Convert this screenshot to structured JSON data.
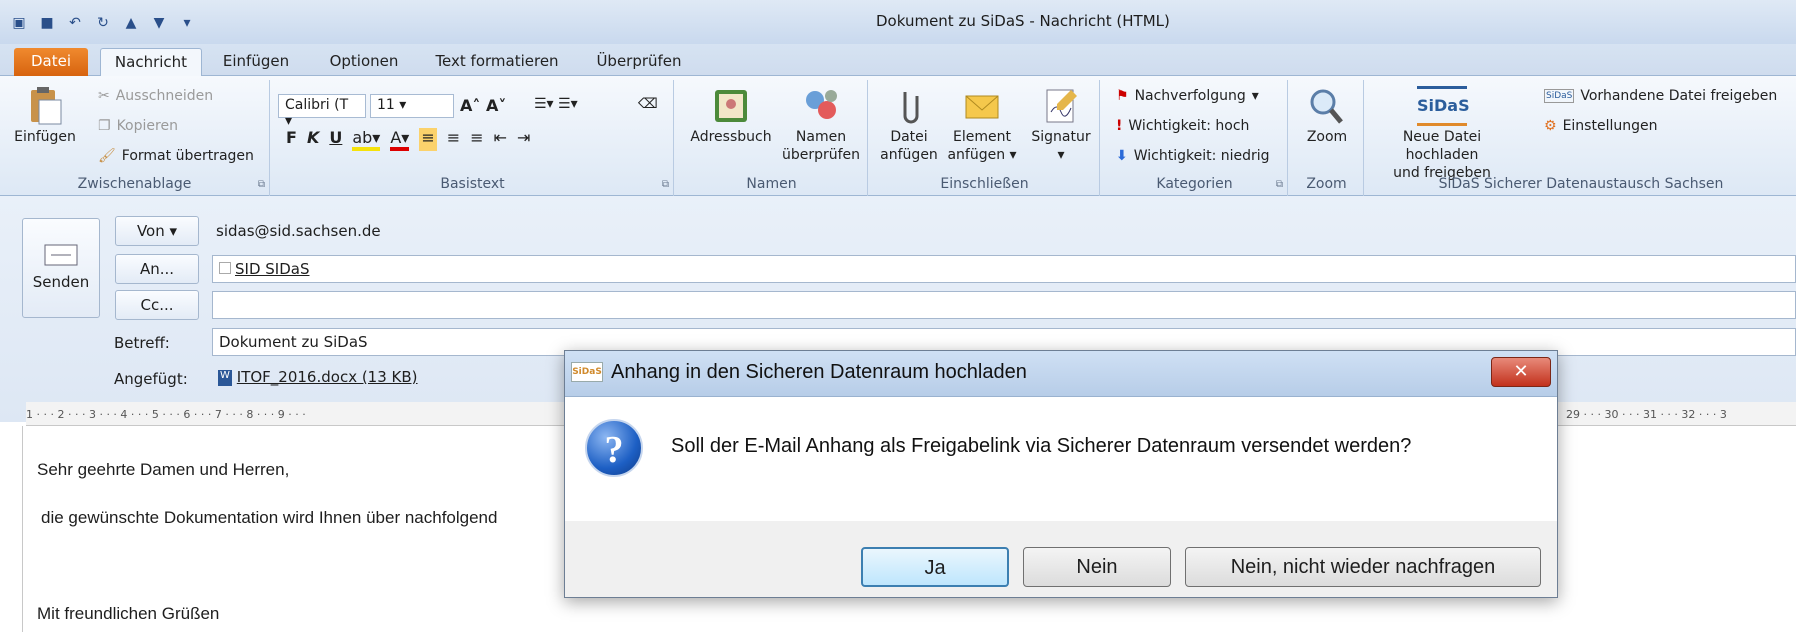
{
  "window": {
    "title": "Dokument zu SiDaS - Nachricht (HTML)"
  },
  "ribbon_tabs": [
    "Datei",
    "Nachricht",
    "Einfügen",
    "Optionen",
    "Text formatieren",
    "Überprüfen"
  ],
  "groups": {
    "clipboard": {
      "label": "Zwischenablage",
      "paste": "Einfügen",
      "cut": "Ausschneiden",
      "copy": "Kopieren",
      "format": "Format übertragen"
    },
    "basictext": {
      "label": "Basistext",
      "font": "Calibri (T",
      "size": "11"
    },
    "names": {
      "label": "Namen",
      "addressbook": "Adressbuch",
      "check_line1": "Namen",
      "check_line2": "überprüfen"
    },
    "include": {
      "label": "Einschließen",
      "attach_line1": "Datei",
      "attach_line2": "anfügen",
      "item_line1": "Element",
      "item_line2": "anfügen",
      "signature": "Signatur"
    },
    "tags": {
      "label": "Kategorien",
      "followup": "Nachverfolgung",
      "high": "Wichtigkeit: hoch",
      "low": "Wichtigkeit: niedrig"
    },
    "zoom": {
      "label": "Zoom",
      "button": "Zoom"
    },
    "sidas": {
      "label": "SiDaS Sicherer Datenaustausch Sachsen",
      "logo": "SiDaS",
      "upload_line1": "Neue Datei hochladen",
      "upload_line2": "und freigeben",
      "share_existing": "Vorhandene Datei freigeben",
      "settings": "Einstellungen"
    }
  },
  "compose": {
    "send": "Senden",
    "from_btn": "Von",
    "from_value": "sidas@sid.sachsen.de",
    "to_btn": "An...",
    "to_value": "SID SIDaS",
    "cc_btn": "Cc...",
    "subject_label": "Betreff:",
    "subject_value": "Dokument zu SiDaS",
    "attached_label": "Angefügt:",
    "attachment": "ITOF_2016.docx (13 KB)"
  },
  "ruler": "1 · · · 2 · · · 3 · · · 4 · · · 5 · · · 6 · · · 7 · · · 8 · · · 9 · · ·",
  "ruler_right": "29 · · · 30 · · · 31 · · · 32 · · · 3",
  "body": {
    "greeting": "Sehr geehrte Damen und Herren,",
    "line": "die gewünschte Dokumentation wird Ihnen über nachfolgend",
    "closing": "Mit freundlichen Grüßen"
  },
  "dialog": {
    "icon": "SiDaS",
    "title": "Anhang in den Sicheren Datenraum hochladen",
    "message": "Soll der E-Mail Anhang als Freigabelink via Sicherer Datenraum versendet werden?",
    "yes": "Ja",
    "no": "Nein",
    "never": "Nein, nicht wieder nachfragen"
  }
}
